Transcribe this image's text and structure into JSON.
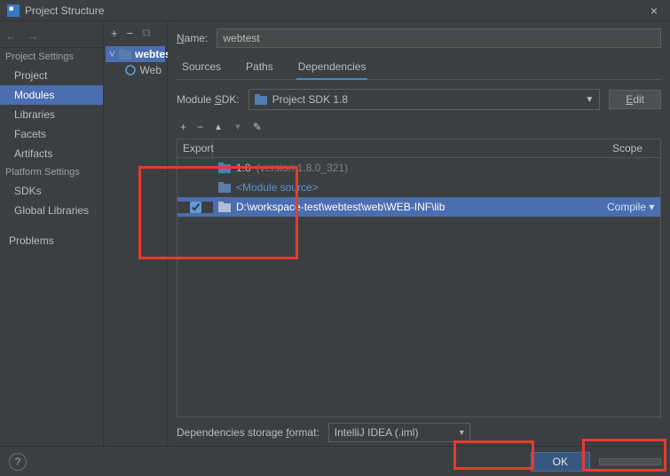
{
  "window": {
    "title": "Project Structure",
    "close": "×"
  },
  "toolbar": {
    "back": "←",
    "forward": "→"
  },
  "sidebar": {
    "section1": "Project Settings",
    "items1": [
      "Project",
      "Modules",
      "Libraries",
      "Facets",
      "Artifacts"
    ],
    "section2": "Platform Settings",
    "items2": [
      "SDKs",
      "Global Libraries"
    ],
    "problems": "Problems"
  },
  "midToolbar": {
    "add": "+",
    "remove": "−",
    "copy": "⧉"
  },
  "tree": {
    "module": "webtest",
    "web": "Web"
  },
  "form": {
    "nameLabel": "Name:",
    "nameValue": "webtest"
  },
  "tabs": [
    "Sources",
    "Paths",
    "Dependencies"
  ],
  "sdk": {
    "label": "Module SDK:",
    "value": "Project SDK 1.8",
    "editBtn": "Edit"
  },
  "depToolbar": {
    "add": "+",
    "remove": "−",
    "up": "▲",
    "down": "▼",
    "edit": "✎"
  },
  "depTable": {
    "colExport": "Export",
    "colScope": "Scope",
    "rows": [
      {
        "type": "jdk",
        "label": "1.8",
        "ver": "(version 1.8.0_321)",
        "checked": false,
        "scope": ""
      },
      {
        "type": "module",
        "label": "<Module source>",
        "checked": false,
        "scope": ""
      },
      {
        "type": "lib",
        "label": "D:\\workspace-test\\webtest\\web\\WEB-INF\\lib",
        "checked": true,
        "scope": "Compile ▾"
      }
    ]
  },
  "storage": {
    "label": "Dependencies storage format:",
    "value": "IntelliJ IDEA (.iml)",
    "drop": "▾"
  },
  "buttons": {
    "ok": "OK",
    "cancel": " "
  },
  "help": "?"
}
